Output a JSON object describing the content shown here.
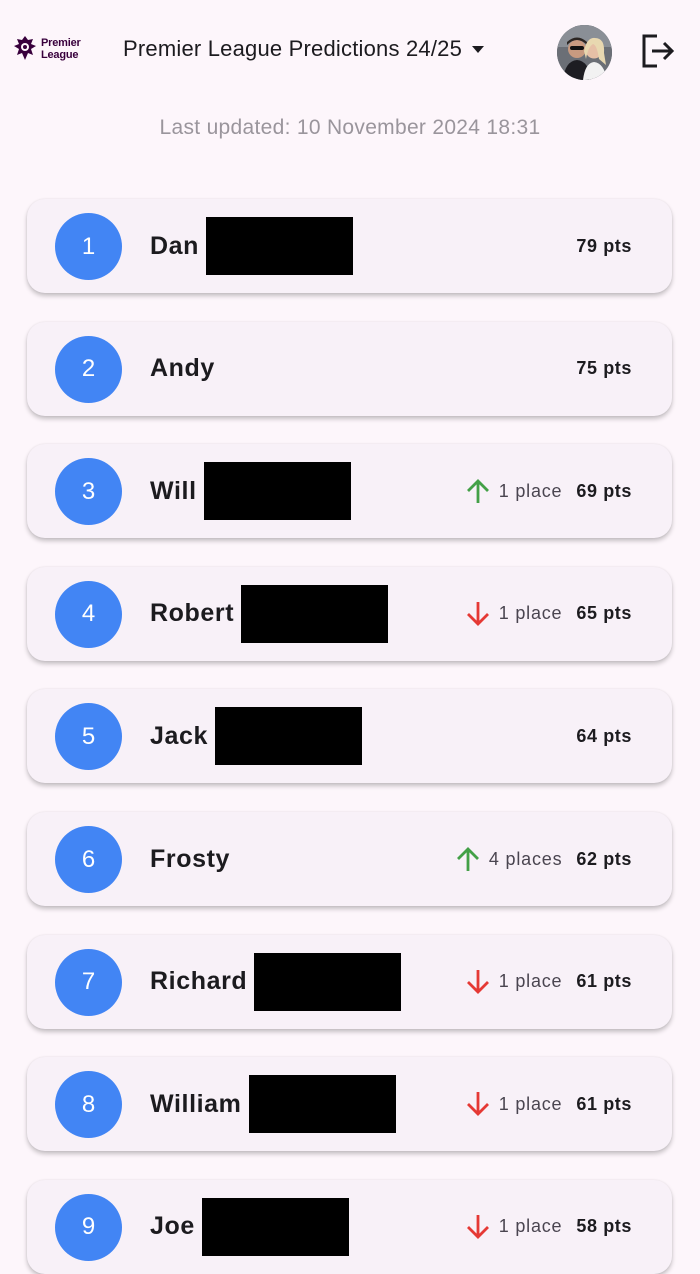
{
  "header": {
    "logo_line1": "Premier",
    "logo_line2": "League",
    "title": "Premier League Predictions 24/25",
    "avatar_icon": "user-avatar",
    "logout_icon": "logout-icon"
  },
  "last_updated": "Last updated: 10 November 2024 18:31",
  "colors": {
    "accent": "#4285f4",
    "up": "#43a047",
    "down": "#e53935",
    "background": "#fdf6fb",
    "card": "#f8f1f8"
  },
  "standings": [
    {
      "rank": "1",
      "name": "Dan",
      "redacted": true,
      "direction": "",
      "movement": "",
      "points": "79 pts"
    },
    {
      "rank": "2",
      "name": "Andy",
      "redacted": false,
      "direction": "",
      "movement": "",
      "points": "75 pts"
    },
    {
      "rank": "3",
      "name": "Will",
      "redacted": true,
      "direction": "up",
      "movement": "1 place",
      "points": "69 pts"
    },
    {
      "rank": "4",
      "name": "Robert",
      "redacted": true,
      "direction": "down",
      "movement": "1 place",
      "points": "65 pts"
    },
    {
      "rank": "5",
      "name": "Jack",
      "redacted": true,
      "direction": "",
      "movement": "",
      "points": "64 pts"
    },
    {
      "rank": "6",
      "name": "Frosty",
      "redacted": false,
      "direction": "up",
      "movement": "4 places",
      "points": "62 pts"
    },
    {
      "rank": "7",
      "name": "Richard",
      "redacted": true,
      "direction": "down",
      "movement": "1 place",
      "points": "61 pts"
    },
    {
      "rank": "8",
      "name": "William",
      "redacted": true,
      "direction": "down",
      "movement": "1 place",
      "points": "61 pts"
    },
    {
      "rank": "9",
      "name": "Joe",
      "redacted": true,
      "direction": "down",
      "movement": "1 place",
      "points": "58 pts"
    }
  ]
}
